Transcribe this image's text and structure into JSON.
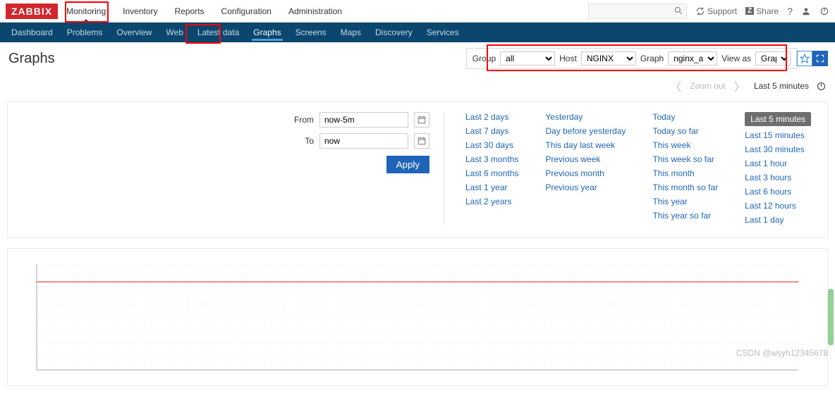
{
  "logo": "ZABBIX",
  "topnav": [
    "Monitoring",
    "Inventory",
    "Reports",
    "Configuration",
    "Administration"
  ],
  "topnav_active": "Monitoring",
  "top_right": {
    "support": "Support",
    "share": "Share"
  },
  "subnav": [
    "Dashboard",
    "Problems",
    "Overview",
    "Web",
    "Latest data",
    "Graphs",
    "Screens",
    "Maps",
    "Discovery",
    "Services"
  ],
  "subnav_active": "Graphs",
  "page_title": "Graphs",
  "filter": {
    "group_label": "Group",
    "group_value": "all",
    "host_label": "Host",
    "host_value": "NGINX",
    "graph_label": "Graph",
    "graph_value": "nginx_alive",
    "view_label": "View as",
    "view_value": "Graph"
  },
  "timenav": {
    "zoom": "Zoom out",
    "label": "Last 5 minutes"
  },
  "timeform": {
    "from_label": "From",
    "from_value": "now-5m",
    "to_label": "To",
    "to_value": "now",
    "apply": "Apply"
  },
  "presets": {
    "c1": [
      "Last 2 days",
      "Last 7 days",
      "Last 30 days",
      "Last 3 months",
      "Last 6 months",
      "Last 1 year",
      "Last 2 years"
    ],
    "c2": [
      "Yesterday",
      "Day before yesterday",
      "This day last week",
      "Previous week",
      "Previous month",
      "Previous year"
    ],
    "c3": [
      "Today",
      "Today so far",
      "This week",
      "This week so far",
      "This month",
      "This month so far",
      "This year",
      "This year so far"
    ],
    "c4": [
      "Last 5 minutes",
      "Last 15 minutes",
      "Last 30 minutes",
      "Last 1 hour",
      "Last 3 hours",
      "Last 6 hours",
      "Last 12 hours",
      "Last 1 day"
    ],
    "c4_selected": "Last 5 minutes"
  },
  "chart_data": {
    "type": "line",
    "title": "",
    "xlabel": "",
    "ylabel": "",
    "series": [
      {
        "name": "nginx_alive",
        "color": "#e74c3c",
        "values": [
          1,
          1,
          1,
          1,
          1,
          1,
          1,
          1,
          1,
          1,
          1,
          1,
          1,
          1,
          1,
          1,
          1,
          1,
          1,
          1,
          1,
          1,
          1,
          1,
          1,
          1,
          1,
          1,
          1,
          1
        ]
      }
    ],
    "x": [
      0,
      1,
      2,
      3,
      4,
      5,
      6,
      7,
      8,
      9,
      10,
      11,
      12,
      13,
      14,
      15,
      16,
      17,
      18,
      19,
      20,
      21,
      22,
      23,
      24,
      25,
      26,
      27,
      28,
      29
    ],
    "ylim": [
      0,
      1.2
    ],
    "grid": true
  },
  "watermark": "CSDN @wsyh12345678"
}
